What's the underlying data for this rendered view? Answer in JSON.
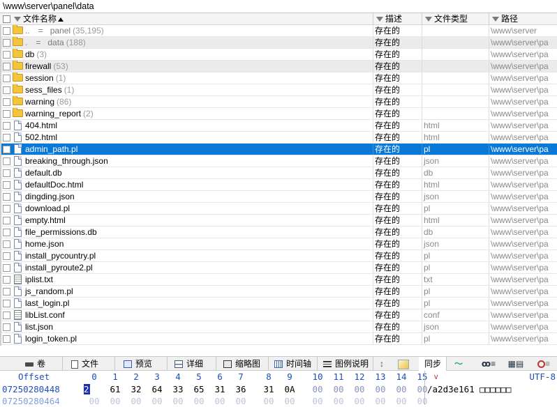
{
  "path": "\\www\\server\\panel\\data",
  "columns": {
    "name": "文件名称",
    "desc": "描述",
    "type": "文件类型",
    "path": "路径"
  },
  "rows": [
    {
      "kind": "dotdot",
      "dots": "..",
      "eq": "=",
      "name": "panel",
      "count": "(35,195)",
      "desc": "存在的",
      "type": "",
      "path": "\\www\\server"
    },
    {
      "kind": "dot",
      "dots": ".",
      "eq": "=",
      "name": "data",
      "count": "(188)",
      "desc": "存在的",
      "type": "",
      "path": "\\www\\server\\pa"
    },
    {
      "kind": "folder",
      "name": "db",
      "count": "(3)",
      "desc": "存在的",
      "type": "",
      "path": "\\www\\server\\pa"
    },
    {
      "kind": "folder",
      "name": "firewall",
      "count": "(53)",
      "desc": "存在的",
      "type": "",
      "path": "\\www\\server\\pa"
    },
    {
      "kind": "folder",
      "name": "session",
      "count": "(1)",
      "desc": "存在的",
      "type": "",
      "path": "\\www\\server\\pa"
    },
    {
      "kind": "folder",
      "name": "sess_files",
      "count": "(1)",
      "desc": "存在的",
      "type": "",
      "path": "\\www\\server\\pa"
    },
    {
      "kind": "folder",
      "name": "warning",
      "count": "(86)",
      "desc": "存在的",
      "type": "",
      "path": "\\www\\server\\pa"
    },
    {
      "kind": "folder",
      "name": "warning_report",
      "count": "(2)",
      "desc": "存在的",
      "type": "",
      "path": "\\www\\server\\pa"
    },
    {
      "kind": "file",
      "name": "404.html",
      "count": "",
      "desc": "存在的",
      "type": "html",
      "path": "\\www\\server\\pa"
    },
    {
      "kind": "file",
      "name": "502.html",
      "count": "",
      "desc": "存在的",
      "type": "html",
      "path": "\\www\\server\\pa"
    },
    {
      "kind": "file",
      "name": "admin_path.pl",
      "count": "",
      "desc": "存在的",
      "type": "pl",
      "path": "\\www\\server\\pa",
      "selected": true
    },
    {
      "kind": "file",
      "name": "breaking_through.json",
      "count": "",
      "desc": "存在的",
      "type": "json",
      "path": "\\www\\server\\pa"
    },
    {
      "kind": "file",
      "name": "default.db",
      "count": "",
      "desc": "存在的",
      "type": "db",
      "path": "\\www\\server\\pa"
    },
    {
      "kind": "file",
      "name": "defaultDoc.html",
      "count": "",
      "desc": "存在的",
      "type": "html",
      "path": "\\www\\server\\pa"
    },
    {
      "kind": "file",
      "name": "dingding.json",
      "count": "",
      "desc": "存在的",
      "type": "json",
      "path": "\\www\\server\\pa"
    },
    {
      "kind": "file",
      "name": "download.pl",
      "count": "",
      "desc": "存在的",
      "type": "pl",
      "path": "\\www\\server\\pa"
    },
    {
      "kind": "file",
      "name": "empty.html",
      "count": "",
      "desc": "存在的",
      "type": "html",
      "path": "\\www\\server\\pa"
    },
    {
      "kind": "file",
      "name": "file_permissions.db",
      "count": "",
      "desc": "存在的",
      "type": "db",
      "path": "\\www\\server\\pa"
    },
    {
      "kind": "file",
      "name": "home.json",
      "count": "",
      "desc": "存在的",
      "type": "json",
      "path": "\\www\\server\\pa"
    },
    {
      "kind": "file",
      "name": "install_pycountry.pl",
      "count": "",
      "desc": "存在的",
      "type": "pl",
      "path": "\\www\\server\\pa"
    },
    {
      "kind": "file",
      "name": "install_pyroute2.pl",
      "count": "",
      "desc": "存在的",
      "type": "pl",
      "path": "\\www\\server\\pa"
    },
    {
      "kind": "txt",
      "name": "iplist.txt",
      "count": "",
      "desc": "存在的",
      "type": "txt",
      "path": "\\www\\server\\pa"
    },
    {
      "kind": "file",
      "name": "js_random.pl",
      "count": "",
      "desc": "存在的",
      "type": "pl",
      "path": "\\www\\server\\pa"
    },
    {
      "kind": "file",
      "name": "last_login.pl",
      "count": "",
      "desc": "存在的",
      "type": "pl",
      "path": "\\www\\server\\pa"
    },
    {
      "kind": "txt",
      "name": "libList.conf",
      "count": "",
      "desc": "存在的",
      "type": "conf",
      "path": "\\www\\server\\pa"
    },
    {
      "kind": "file",
      "name": "list.json",
      "count": "",
      "desc": "存在的",
      "type": "json",
      "path": "\\www\\server\\pa"
    },
    {
      "kind": "file",
      "name": "login_token.pl",
      "count": "",
      "desc": "存在的",
      "type": "pl",
      "path": "\\www\\server\\pa"
    }
  ],
  "tabs": [
    {
      "label": "卷",
      "icon": "volume-icon"
    },
    {
      "label": "文件",
      "icon": "document-icon"
    },
    {
      "label": "预览",
      "icon": "preview-icon"
    },
    {
      "label": "详细",
      "icon": "details-icon"
    },
    {
      "label": "缩略图",
      "icon": "thumbnail-icon"
    },
    {
      "label": "时间轴",
      "icon": "timeline-icon"
    },
    {
      "label": "图例说明",
      "icon": "legend-icon"
    }
  ],
  "toolbar": {
    "sort_glyph": "↕",
    "sync_label": "同步"
  },
  "hex": {
    "header_offset": "Offset",
    "columns": [
      "0",
      "1",
      "2",
      "3",
      "4",
      "5",
      "6",
      "7",
      "8",
      "9",
      "10",
      "11",
      "12",
      "13",
      "14",
      "15"
    ],
    "encoding": "UTF-8",
    "v_mark": "v",
    "rows": [
      {
        "offset": "07250280448",
        "bytes": [
          "2F",
          "61",
          "32",
          "64",
          "33",
          "65",
          "31",
          "36",
          "31",
          "0A",
          "00",
          "00",
          "00",
          "00",
          "00",
          "00"
        ],
        "ascii": "/a2d3e161 □□□□□□"
      },
      {
        "offset": "07250280464",
        "bytes": [
          "00",
          "00",
          "00",
          "00",
          "00",
          "00",
          "00",
          "00",
          "00",
          "00",
          "00",
          "00",
          "00",
          "00",
          "00",
          "00"
        ],
        "ascii": ""
      }
    ]
  },
  "colors": {
    "selection": "#0a78d7",
    "hex_blue": "#1a4fbf",
    "folder": "#f2c53d"
  }
}
